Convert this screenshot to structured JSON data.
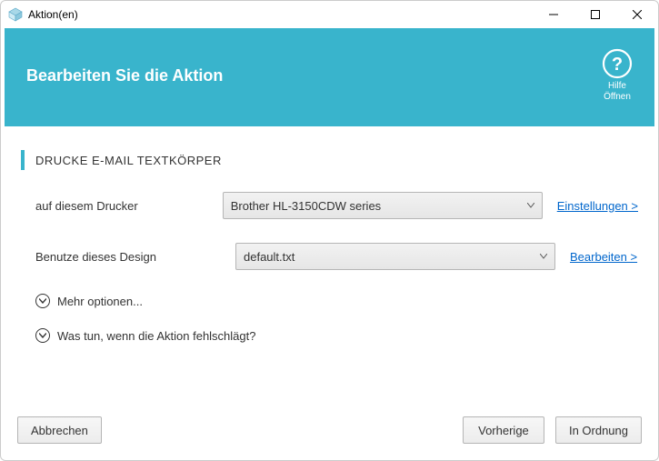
{
  "window": {
    "title": "Aktion(en)"
  },
  "header": {
    "title": "Bearbeiten Sie die Aktion",
    "help_line1": "Hilfe",
    "help_line2": "Öffnen"
  },
  "section": {
    "title": "DRUCKE E-MAIL TEXTKÖRPER"
  },
  "printer": {
    "label": "auf diesem Drucker",
    "selected": "Brother HL-3150CDW series",
    "settings_link": "Einstellungen >"
  },
  "design": {
    "label": "Benutze dieses Design",
    "selected": "default.txt",
    "edit_link": "Bearbeiten >"
  },
  "expanders": {
    "more": "Mehr optionen...",
    "onfail": "Was tun, wenn die Aktion fehlschlägt?"
  },
  "buttons": {
    "cancel": "Abbrechen",
    "previous": "Vorherige",
    "ok": "In Ordnung"
  }
}
